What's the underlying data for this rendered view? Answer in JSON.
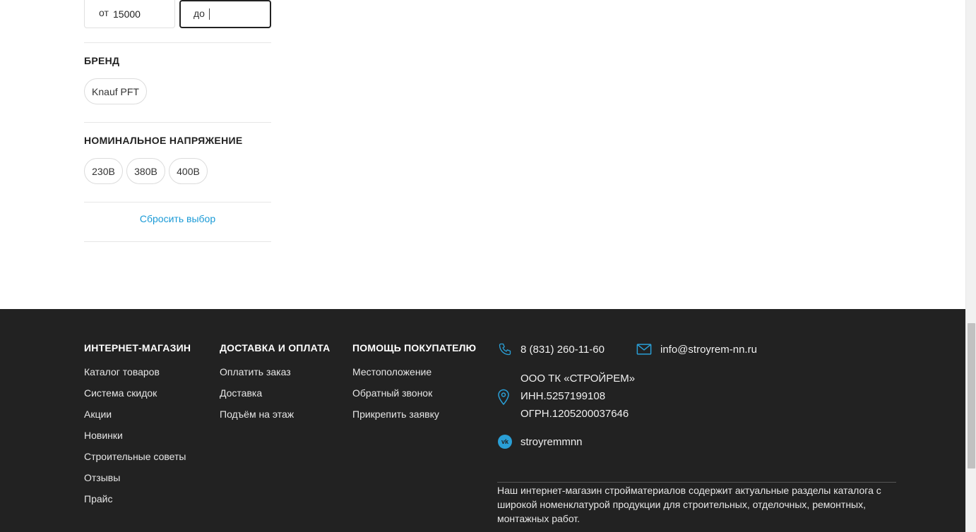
{
  "filters": {
    "price": {
      "from_label": "от",
      "from_value": "15000",
      "to_label": "до",
      "to_value": ""
    },
    "brand": {
      "title": "БРЕНД",
      "options": [
        "Knauf PFT"
      ]
    },
    "voltage": {
      "title": "НОМИНАЛЬНОЕ НАПРЯЖЕНИЕ",
      "options": [
        "230В",
        "380В",
        "400В"
      ]
    },
    "reset_label": "Сбросить выбор"
  },
  "footer": {
    "columns": [
      {
        "title": "ИНТЕРНЕТ-МАГАЗИН",
        "links": [
          "Каталог товаров",
          "Система скидок",
          "Акции",
          "Новинки",
          "Строительные советы",
          "Отзывы",
          "Прайс"
        ]
      },
      {
        "title": "ДОСТАВКА И ОПЛАТА",
        "links": [
          "Оплатить заказ",
          "Доставка",
          "Подъём на этаж"
        ]
      },
      {
        "title": "ПОМОЩЬ ПОКУПАТЕЛЮ",
        "links": [
          "Местоположение",
          "Обратный звонок",
          "Прикрепить заявку"
        ]
      }
    ],
    "contacts": {
      "phone": "8 (831) 260-11-60",
      "email": "info@stroyrem-nn.ru",
      "company": "ООО ТК «СТРОЙРЕМ»",
      "inn": "ИНН.5257199108",
      "ogrn": "ОГРН.1205200037646",
      "vk": "stroyremmnn"
    },
    "description": "Наш интернет-магазин стройматериалов содержит актуальные разделы каталога с широкой номенклатурой продукции для строительных, отделочных, ремонтных, монтажных работ."
  },
  "colors": {
    "accent": "#2a9fd6",
    "footer_bg": "#222222",
    "link": "#1a9ad6"
  },
  "icons": {
    "phone": "phone-icon",
    "email": "envelope-icon",
    "location": "location-pin-icon",
    "vk": "vk-icon"
  }
}
